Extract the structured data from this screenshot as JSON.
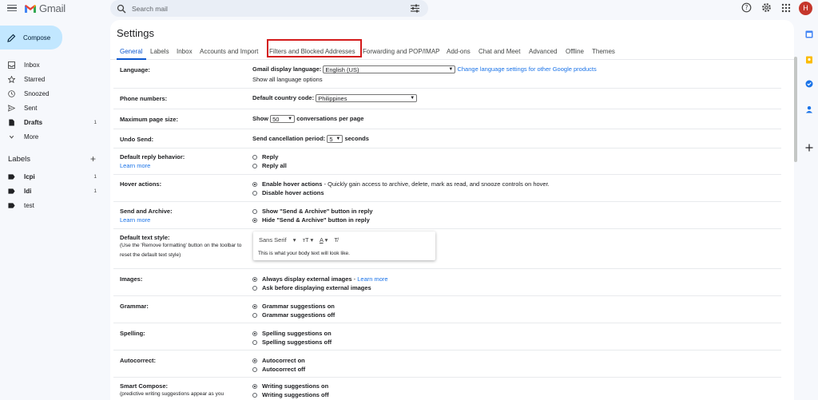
{
  "app": {
    "name": "Gmail"
  },
  "search": {
    "placeholder": "Search mail"
  },
  "header": {
    "avatar_letter": "H"
  },
  "compose": {
    "label": "Compose"
  },
  "nav": [
    {
      "label": "Inbox",
      "count": "",
      "bold": false,
      "icon": "inbox-icon"
    },
    {
      "label": "Starred",
      "count": "",
      "bold": false,
      "icon": "star-icon"
    },
    {
      "label": "Snoozed",
      "count": "",
      "bold": false,
      "icon": "clock-icon"
    },
    {
      "label": "Sent",
      "count": "",
      "bold": false,
      "icon": "send-icon"
    },
    {
      "label": "Drafts",
      "count": "1",
      "bold": true,
      "icon": "draft-icon"
    },
    {
      "label": "More",
      "count": "",
      "bold": false,
      "icon": "chevron-down-icon"
    }
  ],
  "labels_section": {
    "title": "Labels",
    "items": [
      {
        "label": "lcpi",
        "count": "1",
        "bold": true
      },
      {
        "label": "ldi",
        "count": "1",
        "bold": true
      },
      {
        "label": "test",
        "count": "",
        "bold": false
      }
    ]
  },
  "settings": {
    "title": "Settings",
    "tabs": [
      "General",
      "Labels",
      "Inbox",
      "Accounts and Import",
      "Filters and Blocked Addresses",
      "Forwarding and POP/IMAP",
      "Add-ons",
      "Chat and Meet",
      "Advanced",
      "Offline",
      "Themes"
    ],
    "language": {
      "label": "Language:",
      "display_label": "Gmail display language:",
      "value": "English (US)",
      "change_link": "Change language settings for other Google products",
      "show_all": "Show all language options"
    },
    "phone": {
      "label": "Phone numbers:",
      "field": "Default country code:",
      "value": "Philippines"
    },
    "page_size": {
      "label": "Maximum page size:",
      "prefix": "Show",
      "value": "50",
      "suffix": "conversations per page"
    },
    "undo": {
      "label": "Undo Send:",
      "field": "Send cancellation period:",
      "value": "5",
      "suffix": "seconds"
    },
    "reply": {
      "label": "Default reply behavior:",
      "learn": "Learn more",
      "opt1": "Reply",
      "opt2": "Reply all"
    },
    "hover": {
      "label": "Hover actions:",
      "opt1": "Enable hover actions",
      "opt1_desc": " - Quickly gain access to archive, delete, mark as read, and snooze controls on hover.",
      "opt2": "Disable hover actions"
    },
    "send_archive": {
      "label": "Send and Archive:",
      "learn": "Learn more",
      "opt1": "Show \"Send & Archive\" button in reply",
      "opt2": "Hide \"Send & Archive\" button in reply"
    },
    "text_style": {
      "label": "Default text style:",
      "sub1": "(Use the 'Remove formatting' button on the toolbar to",
      "sub2": "reset the default text style)",
      "font": "Sans Serif",
      "sample": "This is what your body text will look like."
    },
    "images": {
      "label": "Images:",
      "opt1": "Always display external images",
      "learn": "Learn more",
      "opt2": "Ask before displaying external images"
    },
    "grammar": {
      "label": "Grammar:",
      "opt1": "Grammar suggestions on",
      "opt2": "Grammar suggestions off"
    },
    "spelling": {
      "label": "Spelling:",
      "opt1": "Spelling suggestions on",
      "opt2": "Spelling suggestions off"
    },
    "autocorrect": {
      "label": "Autocorrect:",
      "opt1": "Autocorrect on",
      "opt2": "Autocorrect off"
    },
    "smart_compose": {
      "label": "Smart Compose:",
      "sub": "(predictive writing suggestions appear as you",
      "opt1": "Writing suggestions on",
      "opt2": "Writing suggestions off"
    }
  }
}
